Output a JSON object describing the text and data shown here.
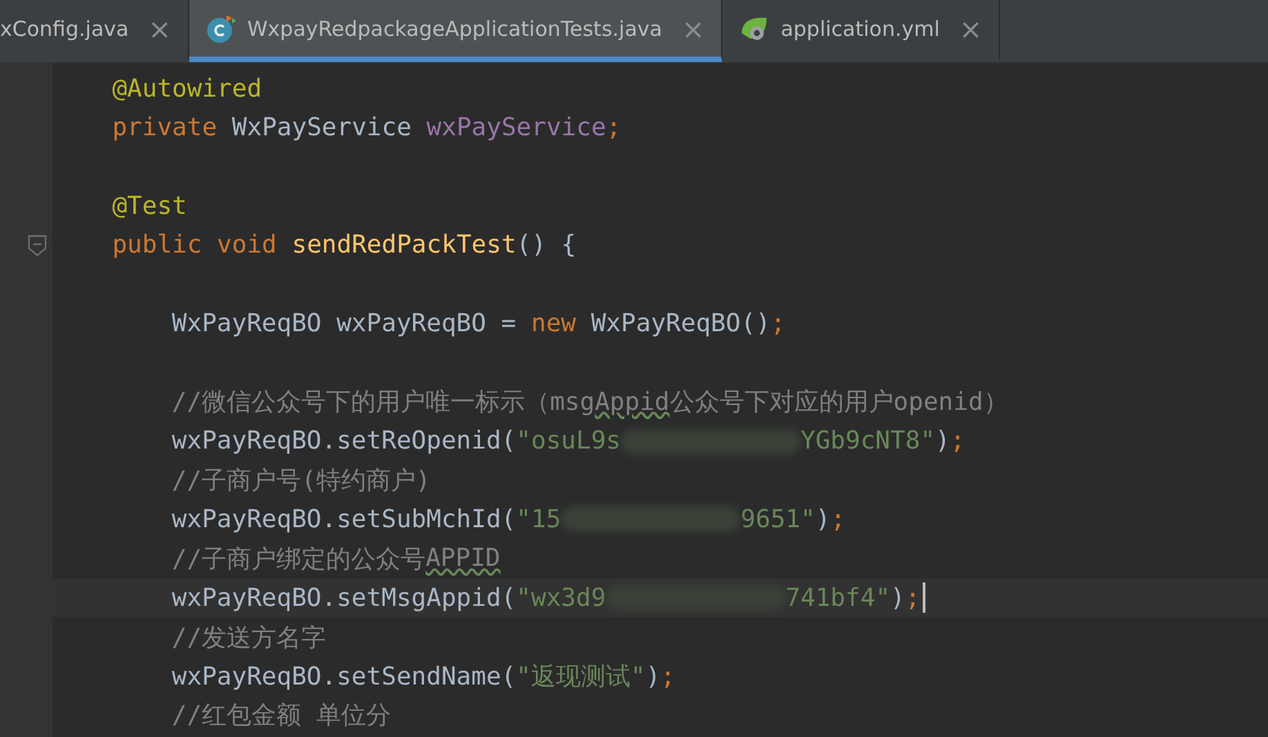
{
  "tabs": [
    {
      "label": "xConfig.java",
      "selected": false
    },
    {
      "label": "WxpayRedpackageApplicationTests.java",
      "selected": true
    },
    {
      "label": "application.yml",
      "selected": false
    }
  ],
  "close_glyph": "×",
  "code": {
    "lines": [
      {
        "kind": "code",
        "current": false,
        "tokens": [
          {
            "kind": "annotation",
            "text": "@Autowired"
          }
        ]
      },
      {
        "kind": "code",
        "current": false,
        "tokens": [
          {
            "kind": "keyword",
            "text": "private "
          },
          {
            "kind": "plain",
            "text": "WxPayService "
          },
          {
            "kind": "field",
            "text": "wxPayService"
          },
          {
            "kind": "keyword",
            "text": ";"
          }
        ]
      },
      {
        "kind": "blank"
      },
      {
        "kind": "code",
        "current": false,
        "tokens": [
          {
            "kind": "annotation",
            "text": "@Test"
          }
        ]
      },
      {
        "kind": "code",
        "current": false,
        "tokens": [
          {
            "kind": "keyword",
            "text": "public void "
          },
          {
            "kind": "method",
            "text": "sendRedPackTest"
          },
          {
            "kind": "plain",
            "text": "() {"
          }
        ],
        "children": [
          {
            "kind": "blank"
          },
          {
            "kind": "code",
            "current": false,
            "tokens": [
              {
                "kind": "plain",
                "text": "WxPayReqBO wxPayReqBO = "
              },
              {
                "kind": "keyword",
                "text": "new "
              },
              {
                "kind": "plain",
                "text": "WxPayReqBO()"
              },
              {
                "kind": "keyword",
                "text": ";"
              }
            ]
          },
          {
            "kind": "blank"
          },
          {
            "kind": "code",
            "current": false,
            "tokens": [
              {
                "kind": "comment",
                "text": "//微信公众号下的用户唯一标示（msg"
              },
              {
                "kind": "typo",
                "text": "Appid"
              },
              {
                "kind": "comment",
                "text": "公众号下对应的用户openid）"
              }
            ]
          },
          {
            "kind": "code",
            "current": false,
            "tokens": [
              {
                "kind": "plain",
                "text": "wxPayReqBO.setReOpenid("
              },
              {
                "kind": "string",
                "text": "\"osuL9s"
              },
              {
                "kind": "redacted"
              },
              {
                "kind": "string",
                "text": "YGb9cNT8\""
              },
              {
                "kind": "plain",
                "text": ")"
              },
              {
                "kind": "keyword",
                "text": ";"
              }
            ]
          },
          {
            "kind": "code",
            "current": false,
            "tokens": [
              {
                "kind": "comment",
                "text": "//子商户号(特约商户)"
              }
            ]
          },
          {
            "kind": "code",
            "current": false,
            "tokens": [
              {
                "kind": "plain",
                "text": "wxPayReqBO.setSubMchId("
              },
              {
                "kind": "string",
                "text": "\"15"
              },
              {
                "kind": "redacted"
              },
              {
                "kind": "string",
                "text": "9651\""
              },
              {
                "kind": "plain",
                "text": ")"
              },
              {
                "kind": "keyword",
                "text": ";"
              }
            ]
          },
          {
            "kind": "code",
            "current": false,
            "tokens": [
              {
                "kind": "comment",
                "text": "//子商户绑定的公众号"
              },
              {
                "kind": "typo",
                "text": "APPID"
              }
            ]
          },
          {
            "kind": "code",
            "current": true,
            "tokens": [
              {
                "kind": "plain",
                "text": "wxPayReqBO.setMsgAppid("
              },
              {
                "kind": "string",
                "text": "\"wx3d9"
              },
              {
                "kind": "redacted"
              },
              {
                "kind": "string",
                "text": "741bf4\""
              },
              {
                "kind": "plain",
                "text": ")"
              },
              {
                "kind": "keyword",
                "text": ";"
              }
            ]
          },
          {
            "kind": "code",
            "current": false,
            "tokens": [
              {
                "kind": "comment",
                "text": "//发送方名字"
              }
            ]
          },
          {
            "kind": "code",
            "current": false,
            "tokens": [
              {
                "kind": "plain",
                "text": "wxPayReqBO.setSendName("
              },
              {
                "kind": "string",
                "text": "\"返现测试\""
              },
              {
                "kind": "plain",
                "text": ")"
              },
              {
                "kind": "keyword",
                "text": ";"
              }
            ]
          },
          {
            "kind": "code",
            "current": false,
            "tokens": [
              {
                "kind": "comment",
                "text": "//红包金额 单位分"
              }
            ]
          }
        ]
      }
    ]
  }
}
